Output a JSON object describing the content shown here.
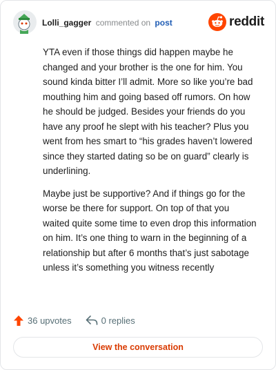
{
  "comment": {
    "username": "Lolli_gagger",
    "action": "commented on",
    "link": "post",
    "paragraphs": [
      "YTA even if those things did happen maybe he changed and your brother is the one for him. You sound kinda bitter I’ll admit. More so like you’re bad mouthing him and going based off rumors. On how he should be judged. Besides your friends do you have any proof he slept with his teacher? Plus you went from hes smart to “his grades haven’t lowered since they started dating so be on guard” clearly is underlining.",
      "Maybe just be supportive? And if things go for the worse be there for support. On top of that you waited quite some time to even drop this information on him. It’s one thing to warn in the beginning of a relationship but after 6 months that’s just sabotage unless it’s something you witness recently"
    ],
    "upvotes": "36 upvotes",
    "replies": "0 replies"
  },
  "brand": {
    "wordmark": "reddit",
    "color": "#ff4500"
  },
  "cta": {
    "label": "View the conversation"
  },
  "icons": {
    "avatar": "snoo-avatar-icon",
    "logo": "reddit-logo-icon",
    "upvote": "upvote-arrow-icon",
    "reply": "reply-arrow-icon"
  }
}
